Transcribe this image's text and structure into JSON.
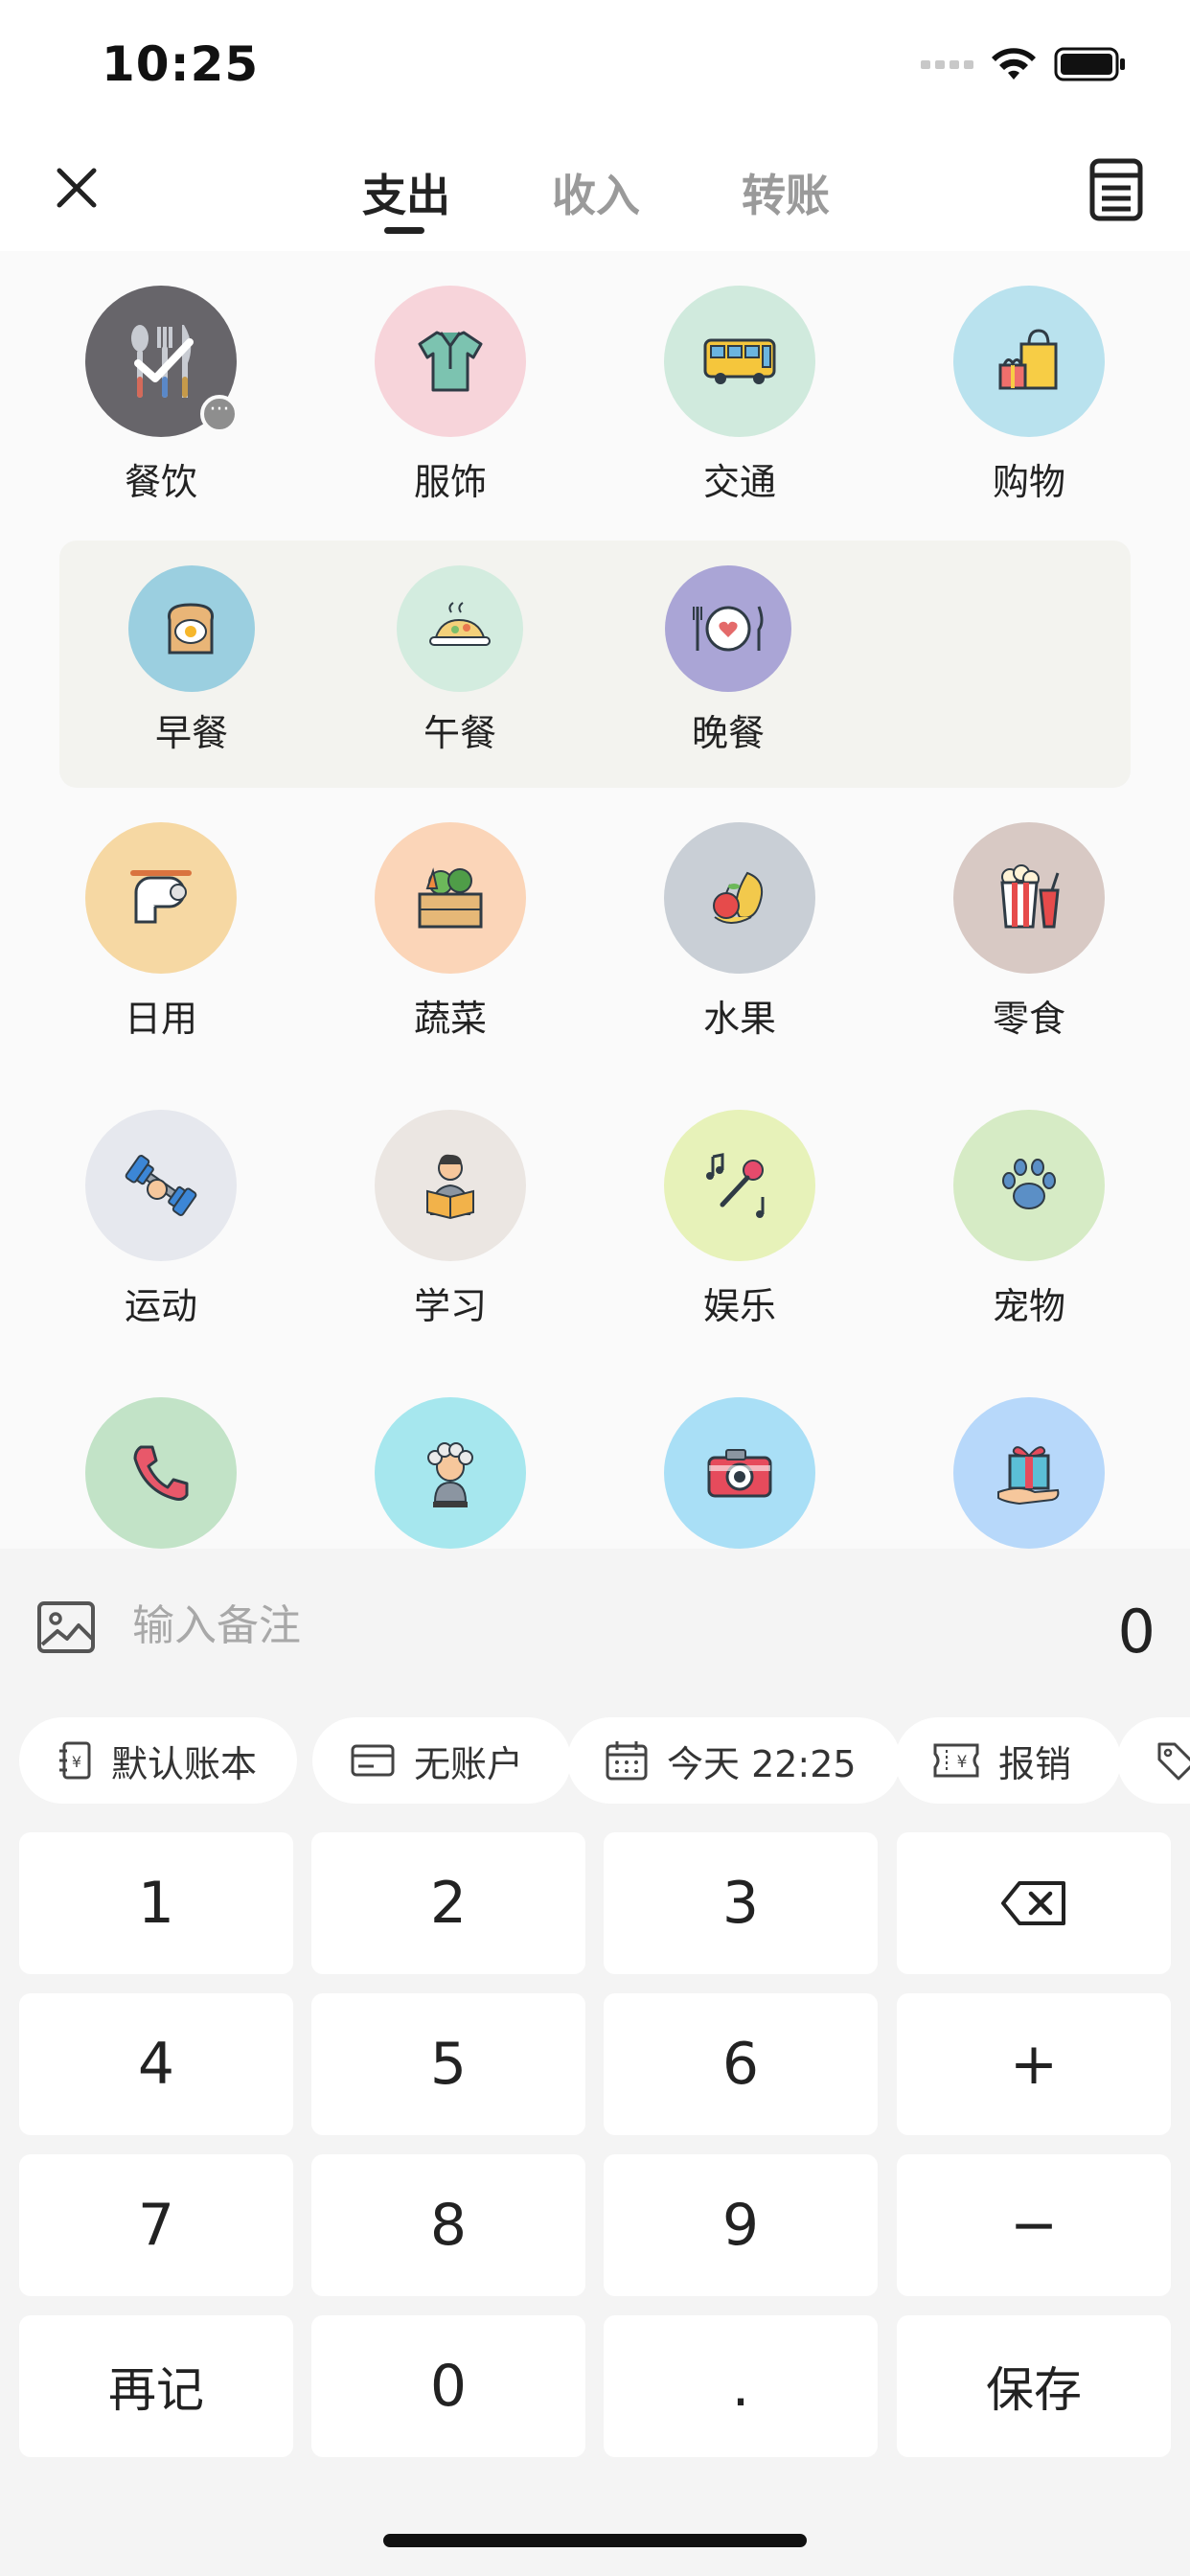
{
  "status_bar": {
    "time": "10:25"
  },
  "tabs": [
    {
      "label": "支出",
      "active": true
    },
    {
      "label": "收入",
      "active": false
    },
    {
      "label": "转账",
      "active": false
    }
  ],
  "categories": {
    "row1": [
      {
        "label": "餐饮",
        "icon": "fork-knife-icon",
        "selected": true
      },
      {
        "label": "服饰",
        "icon": "shirt-icon"
      },
      {
        "label": "交通",
        "icon": "bus-icon"
      },
      {
        "label": "购物",
        "icon": "shopping-bag-icon"
      }
    ],
    "subcategories": [
      {
        "label": "早餐",
        "icon": "toast-egg-icon"
      },
      {
        "label": "午餐",
        "icon": "rice-dish-icon"
      },
      {
        "label": "晚餐",
        "icon": "plate-cutlery-icon"
      }
    ],
    "row2": [
      {
        "label": "日用",
        "icon": "toilet-paper-icon"
      },
      {
        "label": "蔬菜",
        "icon": "vegetable-crate-icon"
      },
      {
        "label": "水果",
        "icon": "fruit-icon"
      },
      {
        "label": "零食",
        "icon": "popcorn-icon"
      }
    ],
    "row3": [
      {
        "label": "运动",
        "icon": "dumbbell-icon"
      },
      {
        "label": "学习",
        "icon": "reading-icon"
      },
      {
        "label": "娱乐",
        "icon": "microphone-icon"
      },
      {
        "label": "宠物",
        "icon": "paw-icon"
      }
    ],
    "row4": [
      {
        "label": "",
        "icon": "phone-icon"
      },
      {
        "label": "",
        "icon": "hair-salon-icon"
      },
      {
        "label": "",
        "icon": "camera-icon"
      },
      {
        "label": "",
        "icon": "gift-icon"
      }
    ]
  },
  "note": {
    "placeholder": "输入备注",
    "value": ""
  },
  "amount": "0",
  "chips": [
    {
      "label": "默认账本",
      "icon": "ledger-icon"
    },
    {
      "label": "无账户",
      "icon": "card-icon"
    },
    {
      "label": "今天 22:25",
      "icon": "calendar-icon"
    },
    {
      "label": "报销",
      "icon": "receipt-icon"
    },
    {
      "label": "",
      "icon": "tag-icon"
    }
  ],
  "keypad": {
    "k1": "1",
    "k2": "2",
    "k3": "3",
    "k4": "4",
    "k5": "5",
    "k6": "6",
    "plus": "+",
    "k7": "7",
    "k8": "8",
    "k9": "9",
    "minus": "−",
    "again": "再记",
    "k0": "0",
    "dot": ".",
    "save": "保存"
  },
  "colors": {
    "dining": "#67656a",
    "clothing": "#f7d4da",
    "transport": "#d0eadd",
    "shopping": "#b9e2ee",
    "breakfast": "#9bcfe0",
    "lunch": "#d3ecdf",
    "dinner": "#aaa5d6",
    "daily": "#f6d8a3",
    "veg": "#fbd5b8",
    "fruit": "#c9cfd6",
    "snack": "#d8c9c4",
    "sport": "#e6e8ee",
    "study": "#ebe6e2",
    "fun": "#e7f2b9",
    "pet": "#d6ebc5",
    "phone": "#c2e3c7",
    "hair": "#a6e7ee",
    "camera": "#a9dff6",
    "gift": "#b7d8fa"
  }
}
